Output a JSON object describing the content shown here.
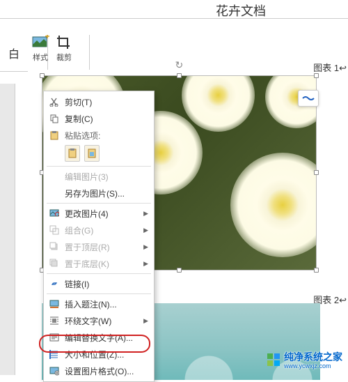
{
  "header": {
    "doc_title": "花卉文档"
  },
  "ribbon": {
    "left_label": "白",
    "style_label": "样式",
    "crop_label": "裁剪"
  },
  "captions": {
    "img1": "图表 1",
    "img2": "图表 2"
  },
  "context_menu": {
    "cut": "剪切(T)",
    "copy": "复制(C)",
    "paste_header": "粘贴选项:",
    "edit_picture": "编辑图片(3)",
    "save_as_picture": "另存为图片(S)...",
    "change_picture": "更改图片(4)",
    "group": "组合(G)",
    "bring_to_front": "置于顶层(R)",
    "send_to_back": "置于底层(K)",
    "link": "链接(I)",
    "insert_caption": "插入题注(N)...",
    "wrap_text": "环绕文字(W)",
    "edit_alt_text": "编辑替换文字(A)...",
    "size_and_position": "大小和位置(Z)...",
    "format_picture": "设置图片格式(O)..."
  },
  "watermark": {
    "text": "纯净系统之家",
    "url": "www.ycwxjz.com"
  }
}
